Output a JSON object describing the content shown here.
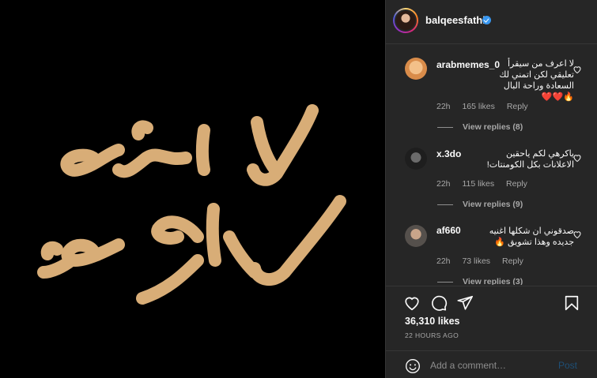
{
  "post": {
    "image_text_line1": "لا احبه",
    "image_text_line2": "لا اكرهه",
    "text_color": "#d8ad77"
  },
  "header": {
    "username": "balqeesfathi",
    "verified": true
  },
  "comments": [
    {
      "username": "arabmemes_0",
      "text": "لا اعرف من سيقرأ تعليقي لكن اتمني لك السعادة وراحة البال 🔥❤️❤️",
      "time": "22h",
      "likes": "165 likes",
      "reply": "Reply",
      "view_replies": "View replies (8)"
    },
    {
      "username": "x.3do",
      "text": "ياكرهي لكم ياحقين الاعلانات بكل الكومنتات!",
      "time": "22h",
      "likes": "115 likes",
      "reply": "Reply",
      "view_replies": "View replies (9)"
    },
    {
      "username": "af660",
      "text": "صدقوني ان شكلها اغنيه جديده وهذا تشويق 🔥",
      "time": "22h",
      "likes": "73 likes",
      "reply": "Reply",
      "view_replies": "View replies (3)"
    }
  ],
  "actions": {
    "likes": "36,310 likes",
    "time": "22 HOURS AGO"
  },
  "add_comment": {
    "placeholder": "Add a comment…",
    "post_label": "Post"
  },
  "colors": {
    "panel_bg": "#262626",
    "accent_blue": "#3897f0",
    "muted": "#a8a8a8"
  },
  "icons": [
    "heart-icon",
    "comment-icon",
    "share-icon",
    "bookmark-icon",
    "emoji-icon",
    "verified-icon"
  ]
}
